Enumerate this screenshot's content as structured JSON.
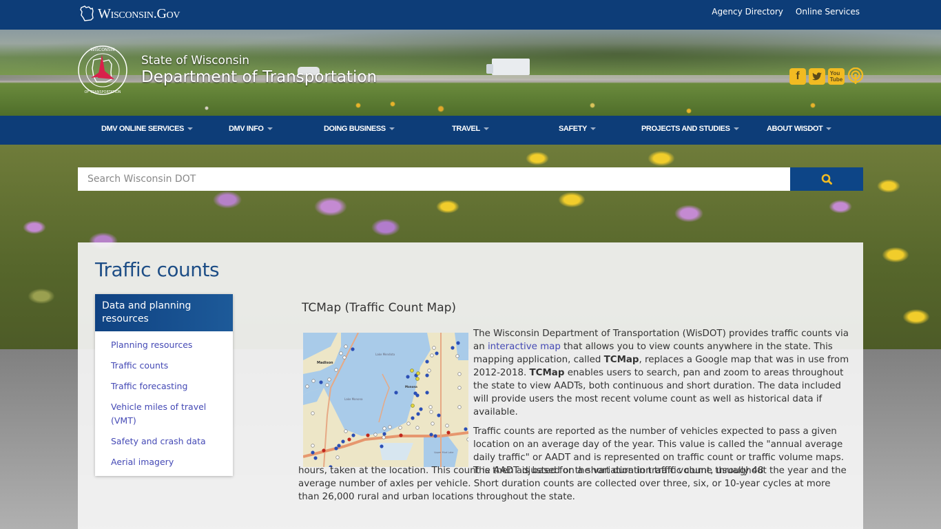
{
  "topbar": {
    "brand": "Wisconsin.Gov",
    "links": [
      "Agency Directory",
      "Online Services"
    ]
  },
  "header": {
    "state": "State of Wisconsin",
    "department": "Department of Transportation",
    "logo_ring_text": "Wisconsin Department of Transportation",
    "social": [
      {
        "name": "facebook",
        "glyph": "f"
      },
      {
        "name": "twitter",
        "glyph": "t"
      },
      {
        "name": "youtube",
        "glyph": "You Tube"
      },
      {
        "name": "podcast",
        "glyph": "podcast"
      }
    ]
  },
  "nav": {
    "items": [
      "DMV ONLINE SERVICES",
      "DMV INFO",
      "DOING BUSINESS",
      "TRAVEL",
      "SAFETY",
      "PROJECTS AND STUDIES",
      "ABOUT WISDOT"
    ]
  },
  "search": {
    "placeholder": "Search Wisconsin DOT",
    "value": "",
    "button_icon": "search-icon"
  },
  "page": {
    "title": "Traffic counts"
  },
  "sidebar": {
    "header": "Data and planning resources",
    "items": [
      "Planning resources",
      "Traffic counts",
      "Traffic forecasting",
      "Vehicle miles of travel (VMT)",
      "Safety and crash data",
      "Aerial imagery"
    ]
  },
  "content": {
    "heading": "TCMap (Traffic Count Map)",
    "map_labels": [
      "Madison",
      "Lake Mendota",
      "Lake Monona",
      "Monona",
      "Upper Mud Lake"
    ],
    "p1": {
      "t1": "The Wisconsin Department of Transportation (WisDOT) provides traffic counts via an ",
      "link": "interactive map",
      "t2": " that allows you to view counts anywhere in the state. This mapping application, called ",
      "b1": "TCMap",
      "t3": ", replaces a Google map that was in use from 2012-2018. ",
      "b2": "TCMap",
      "t4": " enables users to search, pan and zoom to areas throughout the state to view AADTs, both continuous and short duration. The data included will provide users the most recent volume count as well as historical data if available."
    },
    "p2_a": "Traffic counts are reported as the number of vehicles expected to pass a given location on an average day of the year. This value is called the \"annual average daily traffic\" or AADT and is represented on traffic count or traffic volume maps. The AADT is based on a short duration traffic count, usually 48",
    "p2_b": "hours, taken at the location. This count is then adjusted for the variation in traffic volume throughout the year and the average number of axles per vehicle. Short duration counts are collected over three, six, or 10-year cycles at more than 26,000 rural and urban locations throughout the state."
  },
  "colors": {
    "brand_blue": "#0d3d78",
    "accent_gold": "#f2bb22",
    "link": "#4449b5",
    "title_blue": "#1e4e86"
  }
}
